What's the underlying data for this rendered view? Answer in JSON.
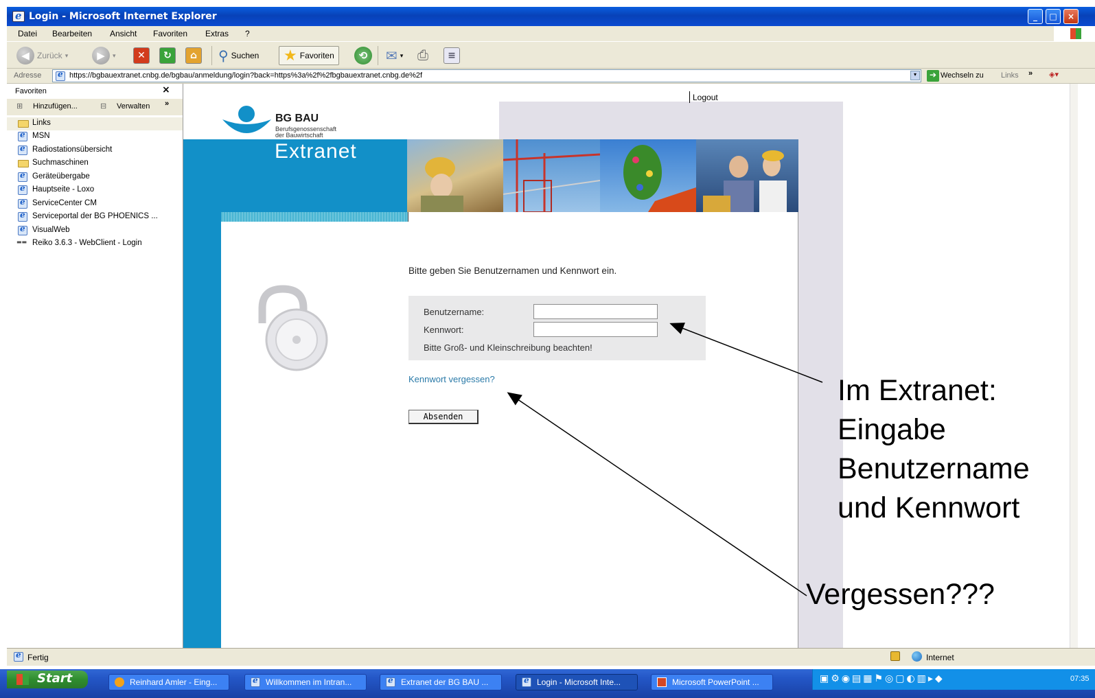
{
  "window": {
    "title": "Login - Microsoft Internet Explorer",
    "minimize": "_",
    "maximize": "□",
    "close": "×"
  },
  "menu": [
    "Datei",
    "Bearbeiten",
    "Ansicht",
    "Favoriten",
    "Extras",
    "?"
  ],
  "toolbar": {
    "back": "Zurück",
    "search": "Suchen",
    "favorites": "Favoriten"
  },
  "address": {
    "label": "Adresse",
    "url": "https://bgbauextranet.cnbg.de/bgbau/anmeldung/login?back=https%3a%2f%2fbgbauextranet.cnbg.de%2f",
    "go": "Wechseln zu",
    "links": "Links",
    "more": "»"
  },
  "sidebar": {
    "title": "Favoriten",
    "close": "×",
    "add": "Hinzufügen...",
    "manage": "Verwalten",
    "more": "»",
    "items": [
      {
        "label": "Links",
        "icon": "folder-icon"
      },
      {
        "label": "MSN",
        "icon": "ie-page-icon"
      },
      {
        "label": "Radiostationsübersicht",
        "icon": "ie-page-icon"
      },
      {
        "label": "Suchmaschinen",
        "icon": "folder-icon"
      },
      {
        "label": "Geräteübergabe",
        "icon": "ie-page-icon"
      },
      {
        "label": "Hauptseite - Loxo",
        "icon": "ie-page-icon"
      },
      {
        "label": "ServiceCenter CM",
        "icon": "ie-page-icon"
      },
      {
        "label": "Serviceportal der BG PHOENICS ...",
        "icon": "ie-page-icon"
      },
      {
        "label": "VisualWeb",
        "icon": "ie-page-icon"
      },
      {
        "label": "Reiko 3.6.3 - WebClient - Login",
        "icon": "reiko-icon"
      }
    ]
  },
  "page": {
    "logout": "Logout",
    "logo_name": "BG BAU",
    "logo_sub1": "Berufsgenossenschaft",
    "logo_sub2": "der Bauwirtschaft",
    "section": "Extranet",
    "prompt": "Bitte geben Sie Benutzernamen und Kennwort ein.",
    "username_label": "Benutzername:",
    "password_label": "Kennwort:",
    "username_value": "",
    "password_value": "",
    "case_hint": "Bitte Groß- und Kleinschreibung beachten!",
    "forgot": "Kennwort vergessen?",
    "submit": "Absenden"
  },
  "annotations": {
    "main_lines": [
      "Im Extranet:",
      "Eingabe",
      "Benutzername",
      "und Kennwort"
    ],
    "forgot": "Vergessen???"
  },
  "status": {
    "text": "Fertig",
    "zone": "Internet"
  },
  "taskbar": {
    "start": "Start",
    "tasks": [
      "Reinhard Amler - Eing...",
      "Willkommen im Intran...",
      "Extranet der BG BAU ...",
      "Login - Microsoft Inte...",
      "Microsoft PowerPoint ..."
    ],
    "clock": "07:35"
  },
  "colors": {
    "xp_blue": "#0a4ad0",
    "bgbau_blue": "#1290c8",
    "link": "#2a7aa8"
  }
}
